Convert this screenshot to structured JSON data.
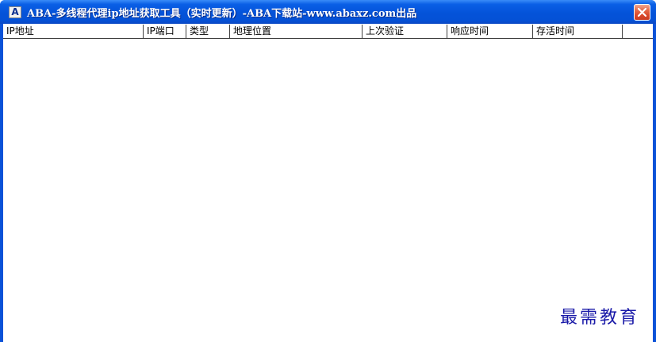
{
  "window": {
    "title": "ABA-多线程代理ip地址获取工具（实时更新）-ABA下载站-www.abaxz.com出品",
    "icon_letter": "A",
    "icon": "app-icon",
    "close_icon": "close-icon"
  },
  "table": {
    "columns": [
      {
        "label": "IP地址"
      },
      {
        "label": "IP端口"
      },
      {
        "label": "类型"
      },
      {
        "label": "地理位置"
      },
      {
        "label": "上次验证"
      },
      {
        "label": "响应时间"
      },
      {
        "label": "存活时间"
      }
    ],
    "rows": []
  },
  "watermark": {
    "text": "最需教育"
  },
  "colors": {
    "titlebar": "#0453d9",
    "close_button": "#d9482a",
    "watermark": "#1a1aa8"
  }
}
